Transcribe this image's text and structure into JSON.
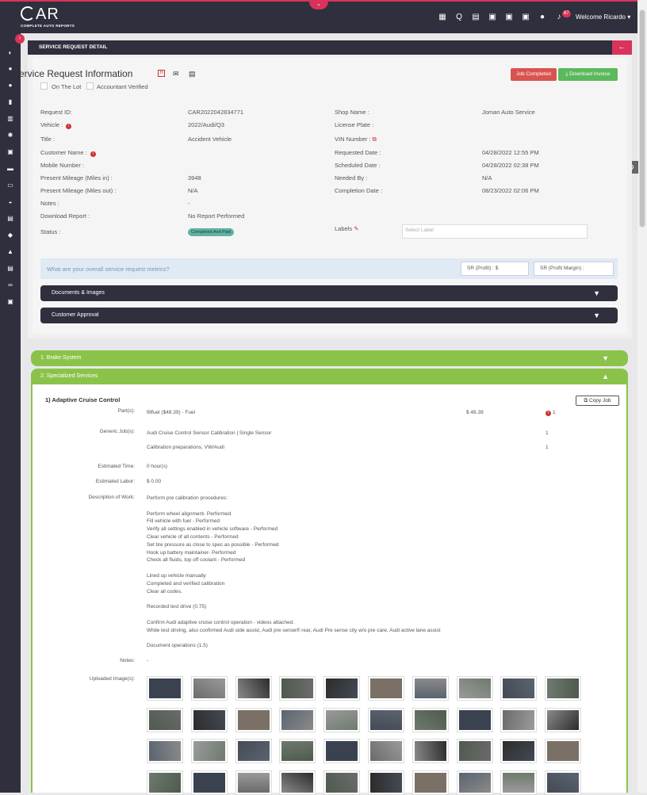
{
  "brand": {
    "logo_big": "AR",
    "logo_small": "COMPLETE AUTO REPORTS"
  },
  "topbar": {
    "notif_count": "87",
    "welcome": "Welcome Ricardo ▾"
  },
  "page": {
    "header": "SERVICE REQUEST DETAIL"
  },
  "sr": {
    "title": "Service Request Information",
    "on_the_lot": "On The Lot",
    "accountant_verified": "Accountant Verified",
    "btn_job_completed": "Job Completed",
    "btn_download_invoice": "Download Invoice"
  },
  "fields": {
    "left": [
      {
        "label": "Request ID:",
        "value": "CAR2022042834771"
      },
      {
        "label": "Vehicle :",
        "value": "2022/Audi/Q3"
      },
      {
        "label": "Title :",
        "value": "Accident Vehicle"
      },
      {
        "label": "Customer Name :",
        "value": ""
      },
      {
        "label": "Mobile Number :",
        "value": ""
      },
      {
        "label": "Present Mileage (Miles in) :",
        "value": "3948"
      },
      {
        "label": "Present Mileage (Miles out) :",
        "value": "N/A"
      },
      {
        "label": "Notes :",
        "value": "-"
      },
      {
        "label": "Download Report :",
        "value": "No Report Performed"
      },
      {
        "label": "Status :",
        "value": ""
      }
    ],
    "right": [
      {
        "label": "Shop Name :",
        "value": "Joman Auto Service"
      },
      {
        "label": "License Plate :",
        "value": ""
      },
      {
        "label": "VIN Number :",
        "value": ""
      },
      {
        "label": "Requested Date :",
        "value": "04/28/2022 12:55 PM"
      },
      {
        "label": "Scheduled Date :",
        "value": "04/28/2022 02:38 PM"
      },
      {
        "label": "Needed By :",
        "value": "N/A"
      },
      {
        "label": "Completion Date :",
        "value": "08/23/2022 02:06 PM"
      },
      {
        "label": "Labels",
        "value": ""
      }
    ],
    "status_badge": "Completed And Paid",
    "labels_placeholder": "Select Label"
  },
  "metrics": {
    "question": "What are your overall service request metrics?",
    "profit": "SR (Profit) : $",
    "margin": "SR (Profit Margin) :"
  },
  "accordions": {
    "docs": "Documents & Images",
    "approval": "Customer Approval",
    "brake": "1. Brake System",
    "specialized": "2. Specialized Services"
  },
  "service": {
    "title": "1) Adaptive Cruise Control",
    "copy_job": "Copy Job",
    "parts_label": "Part(s):",
    "part_name": "fillfuel ($48.39) - Fuel",
    "part_price": "$ 48.39",
    "part_qty": "1",
    "generic_label": "Generic Job(s):",
    "jobs": [
      {
        "name": "Audi Cruise Control Sensor Calibration | Single Sensor",
        "qty": "1"
      },
      {
        "name": "Calibration preparations, VW/Audi",
        "qty": "1"
      }
    ],
    "est_time_label": "Estimated Time:",
    "est_time": "0 hour(s)",
    "est_labor_label": "Estimated Labor:",
    "est_labor": "$ 0.00",
    "desc_label": "Description of Work:",
    "description": "Perform pre calibration procedures:\n\nPerform wheel alignment- Performed\nFill vehicle with fuel - Performed\nVerify all settings enabled in vehicle software - Performed\nClear vehicle of all contents - Performed\nSet tire pressure as close to spec as possible - Performed\nHook up battery maintainer- Performed\nCheck all fluids, top off coolant - Performed\n\nLined up vehicle manually\nCompleted and verified calibration\nClear all codes.\n\nRecorded test drive (0.75)\n\nConfirm Audi adaptive cruise control operation - videos attached.\nWhile test driving, also confirmed Audi side assist, Audi pre sense® rear, Audi Pre sense city w/o pre care, Audi active lane assist\n\nDocument operations (1.5)",
    "notes_label": "Notes:",
    "notes": "-",
    "images_label": "Uploaded Image(s):"
  },
  "colors": {
    "brand": "#d9335a",
    "dark": "#2f2f3d",
    "green": "#8bc34a",
    "btn_red": "#d9534f",
    "btn_green": "#5cb85c"
  }
}
